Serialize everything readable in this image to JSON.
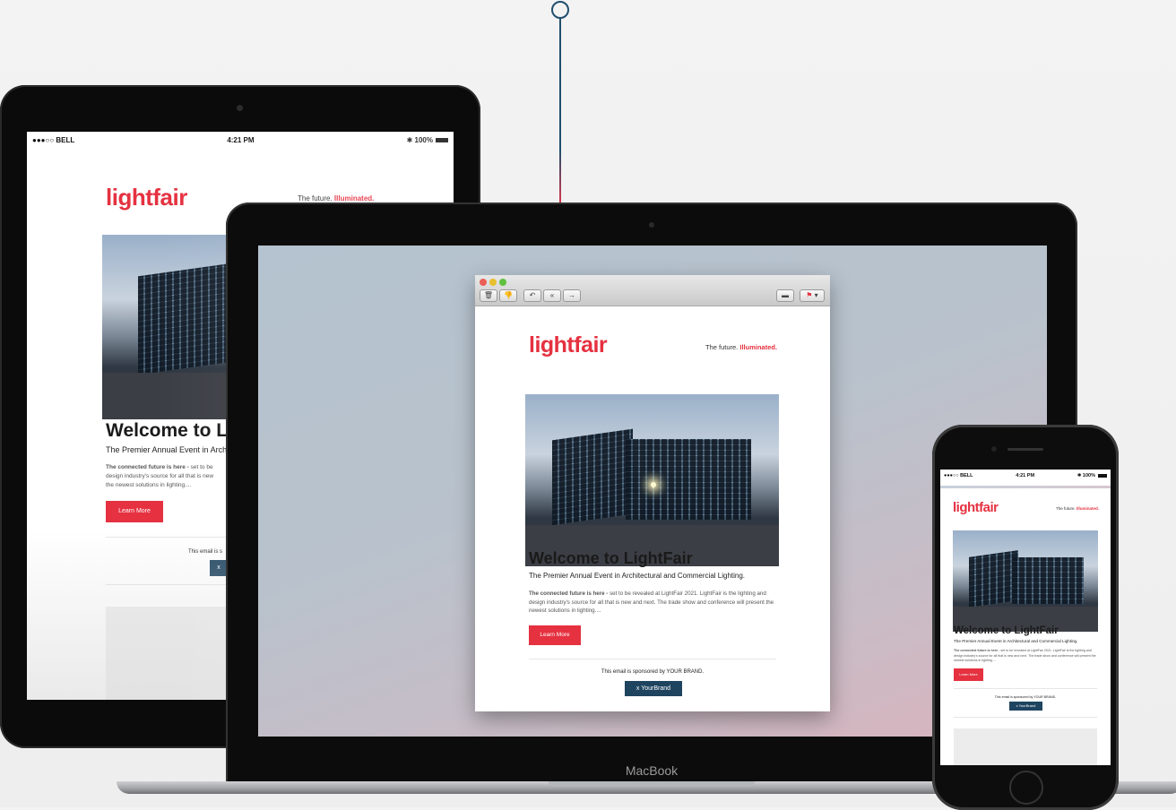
{
  "status_bar": {
    "carrier": "●●●○○ BELL",
    "time": "4:21 PM",
    "battery": "100%"
  },
  "email": {
    "logo": "lightfair",
    "tagline_prefix": "The future.",
    "tagline_highlight": "Illuminated.",
    "headline": "Welcome to LightFair",
    "subheadline": "The Premier Annual Event in Architectural and Commercial Lighting.",
    "body_bold": "The connected future is here -",
    "body_text": " set to be revealed at LightFair 2021. LightFair is the lighting and design industry's source for all that is new and next. The trade show and conference will present the newest solutions in lighting....",
    "cta_label": "Learn More",
    "sponsor_text": "This email is sponsored by YOUR BRAND.",
    "sponsor_button": "x YourBrand"
  },
  "ipad_truncated": {
    "headline": "Welcome to Li",
    "subheadline": "The Premier Annual Event in Arch",
    "body_bold": "The connected future is here -",
    "body_line1": " set to be",
    "body_line2": "design industry's source for all that is new",
    "body_line3": "the newest solutions in lighting....",
    "sponsor_text": "This email is s",
    "sponsor_button": "x"
  },
  "iphone_headline": "Welcome to LightFair",
  "mail_toolbar": {
    "icons": [
      "trash-icon",
      "junk-icon",
      "reply-icon",
      "reply-all-icon",
      "forward-icon",
      "print-icon",
      "flag-icon"
    ]
  },
  "device_label": "MacBook",
  "colors": {
    "brand_red": "#e53140",
    "navy": "#1e4460",
    "connector": "#1f4e6e"
  }
}
